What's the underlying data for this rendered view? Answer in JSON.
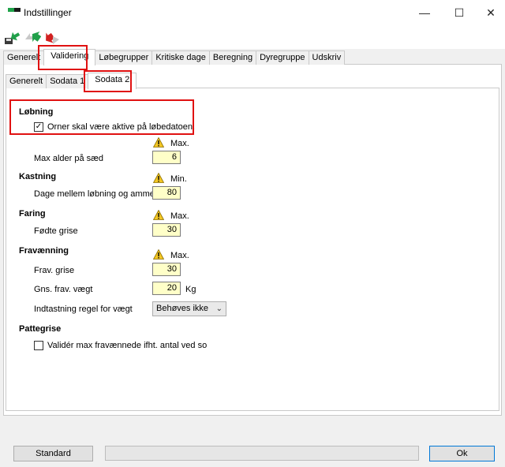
{
  "window": {
    "title": "Indstillinger",
    "min_glyph": "—",
    "max_glyph": "☐",
    "close_glyph": "✕"
  },
  "outer_tabs": [
    "Generelt",
    "Validering",
    "Løbegrupper",
    "Kritiske dage",
    "Beregning",
    "Dyregruppe",
    "Udskriv"
  ],
  "inner_tabs": [
    "Generelt",
    "Sodata 1",
    "Sodata 2"
  ],
  "sections": {
    "lobning": {
      "title": "Løbning",
      "checkbox_label": "Orner skal være aktive på løbedatoen.",
      "checkbox_checked": true,
      "header": "Max.",
      "field_label": "Max alder på sæd",
      "field_value": "6"
    },
    "kastning": {
      "title": "Kastning",
      "header": "Min.",
      "field_label": "Dage mellem løbning og ammeso",
      "field_value": "80"
    },
    "faring": {
      "title": "Faring",
      "header": "Max.",
      "field_label": "Fødte grise",
      "field_value": "30"
    },
    "fravaenning": {
      "title": "Fravænning",
      "header": "Max.",
      "frav_grise_label": "Frav. grise",
      "frav_grise_value": "30",
      "vaegt_label": "Gns. frav. vægt",
      "vaegt_value": "20",
      "vaegt_unit": "Kg",
      "regel_label": "Indtastning regel for vægt",
      "regel_value": "Behøves ikke"
    },
    "pattegrise": {
      "title": "Pattegrise",
      "checkbox_label": "Validér max fravænnede ifht. antal ved so",
      "checkbox_checked": false
    }
  },
  "footer": {
    "standard_label": "Standard",
    "ok_label": "Ok"
  },
  "colors": {
    "highlight": "#e01111",
    "input_bg": "#ffffc8",
    "warning": "#f3c623"
  }
}
